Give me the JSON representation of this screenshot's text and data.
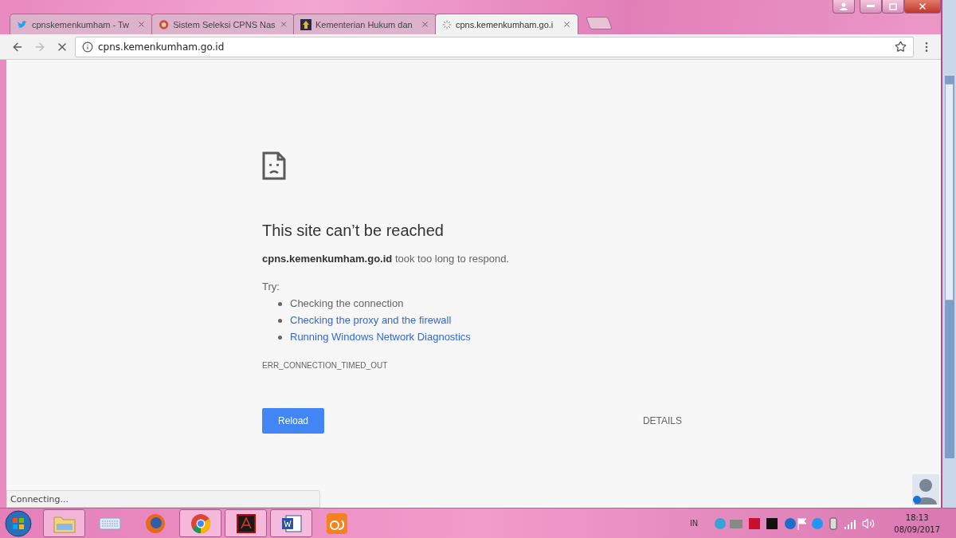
{
  "tabs": [
    {
      "title": "cpnskemenkumham - Tw",
      "kind": "bird",
      "selected": false
    },
    {
      "title": "Sistem Seleksi CPNS Nas",
      "kind": "emblem",
      "selected": false
    },
    {
      "title": "Kementerian Hukum dan",
      "kind": "crest",
      "selected": false
    },
    {
      "title": "cpns.kemenkumham.go.i",
      "kind": "loading",
      "selected": true
    }
  ],
  "address": "cpns.kemenkumham.go.id",
  "error": {
    "title": "This site can’t be reached",
    "message": "**cpns.kemenkumham.go.id** took too long to respond.",
    "try_label": "Try:",
    "suggestions": [
      {
        "text": "Checking the connection",
        "kind": "text"
      },
      {
        "text": "Checking the proxy and the firewall",
        "kind": "link"
      },
      {
        "text": "Running Windows Network Diagnostics",
        "kind": "link"
      }
    ],
    "code": "ERR_CONNECTION_TIMED_OUT",
    "reload": "Reload",
    "details": "DETAILS"
  },
  "status_bar": "Connecting...",
  "taskbar": {
    "apps": [
      {
        "kind": "folder",
        "running": true
      },
      {
        "kind": "keyboard",
        "running": false
      },
      {
        "kind": "firefox",
        "running": false
      },
      {
        "kind": "chrome",
        "running": true
      },
      {
        "kind": "pdf",
        "running": true
      },
      {
        "kind": "word",
        "running": true
      },
      {
        "kind": "squirrel",
        "running": false
      }
    ],
    "language": "IN",
    "time": "18:13",
    "date": "08/09/2017"
  }
}
